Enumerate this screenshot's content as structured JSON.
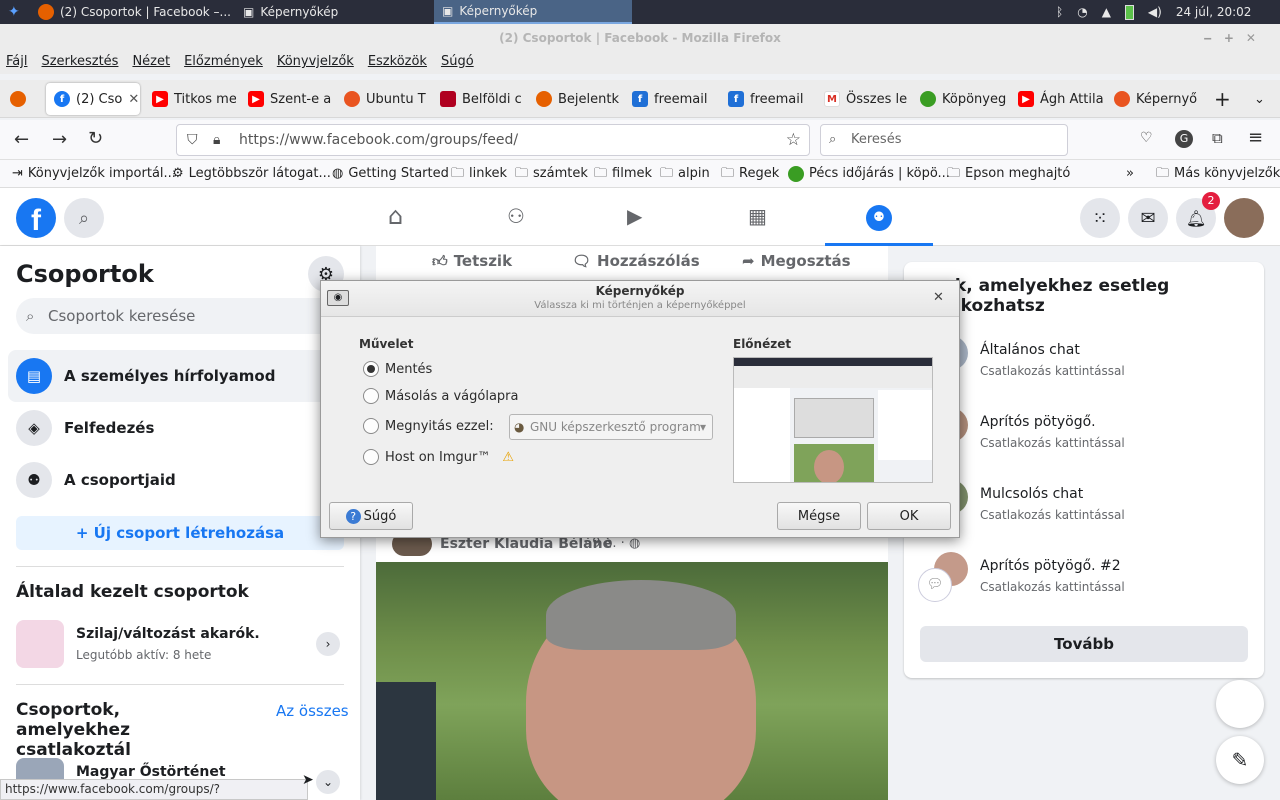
{
  "taskbar": {
    "tasks": [
      "(2) Csoportok | Facebook –...",
      "Képernyőkép",
      "Képernyőkép"
    ],
    "clock": "24 júl, 20:02"
  },
  "window_title": "(2) Csoportok | Facebook - Mozilla Firefox",
  "menu": [
    "Fájl",
    "Szerkesztés",
    "Nézet",
    "Előzmények",
    "Könyvjelzők",
    "Eszközök",
    "Súgó"
  ],
  "tabs": [
    "(2) Cso",
    "Titkos me",
    "Szent-e a",
    "Ubuntu T",
    "Belföldi c",
    "Bejelentk",
    "freemail",
    "freemail",
    "Összes le",
    "Köpönyeg",
    "Ágh Attila",
    "Képernyő"
  ],
  "url": "https://www.facebook.com/groups/feed/",
  "search_placeholder": "Keresés",
  "bookmarks": [
    "Könyvjelzők importál...",
    "Legtöbbször látogat...",
    "Getting Started",
    "linkek",
    "számtek",
    "filmek",
    "alpin",
    "Regek",
    "Pécs időjárás | köpö...",
    "Epson meghajtó",
    "Más könyvjelzők"
  ],
  "fb": {
    "notif_count": "2",
    "sidebar": {
      "title": "Csoportok",
      "search_placeholder": "Csoportok keresése",
      "items": [
        "A személyes hírfolyamod",
        "Felfedezés",
        "A csoportjaid"
      ],
      "create": "Új csoport létrehozása",
      "managed_title": "Általad kezelt csoportok",
      "managed_group": "Szilaj/változást akarók.",
      "managed_sub": "Legutóbb aktív: 8 hete",
      "joined_title": "Csoportok, amelyekhez csatlakoztál",
      "see_all": "Az összes",
      "joined_group": "Magyar Őstörténet"
    },
    "feed": {
      "like": "Tetszik",
      "comment": "Hozzászólás",
      "share": "Megosztás",
      "author": "Eszter Klaudia Béláné",
      "meta": "· 9 ó. ·"
    },
    "right": {
      "title": "...ek, amelyekhez esetleg ...lakozhatsz",
      "items": [
        {
          "name": "Általános chat",
          "sub": "Csatlakozás kattintással"
        },
        {
          "name": "Aprítós pötyögő.",
          "sub": "Csatlakozás kattintással"
        },
        {
          "name": "Mulcsolós chat",
          "sub": "Csatlakozás kattintással"
        },
        {
          "name": "Aprítós pötyögő. #2",
          "sub": "Csatlakozás kattintással"
        }
      ],
      "more": "Tovább"
    }
  },
  "dialog": {
    "title": "Képernyőkép",
    "subtitle": "Válassza ki mi történjen a képernyőképpel",
    "action_label": "Művelet",
    "preview_label": "Előnézet",
    "options": [
      "Mentés",
      "Másolás a vágólapra",
      "Megnyitás ezzel:",
      "Host on Imgur™"
    ],
    "app": "GNU képszerkesztő program",
    "help": "Súgó",
    "cancel": "Mégse",
    "ok": "OK"
  },
  "status_url": "https://www.facebook.com/groups/?category=create"
}
